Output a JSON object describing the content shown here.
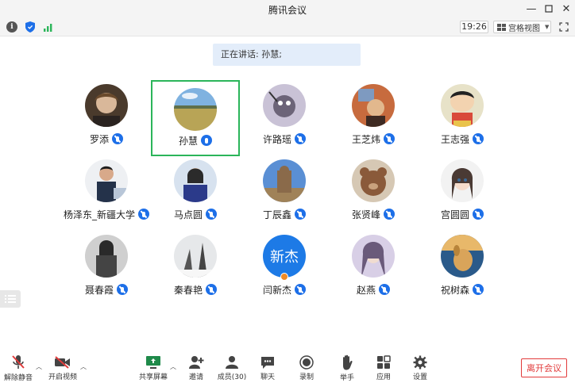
{
  "window": {
    "title": "腾讯会议"
  },
  "toolbar": {
    "time": "19:26",
    "view_label": "宫格视图",
    "icons": [
      "info-icon",
      "shield-icon",
      "signal-icon",
      "fullscreen-icon"
    ]
  },
  "speaking": {
    "text": "正在讲话: 孙慧;"
  },
  "participants": [
    {
      "name": "罗添"
    },
    {
      "name": "孙慧"
    },
    {
      "name": "许路瑶"
    },
    {
      "name": "王芝炜"
    },
    {
      "name": "王志强"
    },
    {
      "name": "杨泽东_新疆大学"
    },
    {
      "name": "马点圆"
    },
    {
      "name": "丁辰鑫"
    },
    {
      "name": "张贤峰"
    },
    {
      "name": "宫圆圆"
    },
    {
      "name": "聂春霞"
    },
    {
      "name": "秦春艳"
    },
    {
      "name": "闫新杰",
      "avatar_text": "新杰"
    },
    {
      "name": "赵燕"
    },
    {
      "name": "祝树森"
    }
  ],
  "bottombar": {
    "unmute": "解除静音",
    "video": "开启视频",
    "share": "共享屏幕",
    "invite": "邀请",
    "members": "成员(30)",
    "chat": "聊天",
    "record": "录制",
    "raise_hand": "举手",
    "apps": "应用",
    "settings": "设置",
    "leave": "离开会议"
  },
  "colors": {
    "accent": "#1d6fe8",
    "active_border": "#2bb55a",
    "leave": "#e23b3b",
    "banner": "#e3edfa"
  }
}
